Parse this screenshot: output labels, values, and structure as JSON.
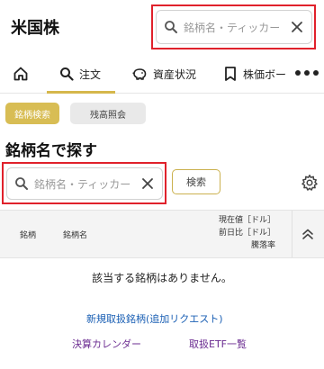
{
  "header": {
    "title": "米国株",
    "search_placeholder": "銘柄名・ティッカー"
  },
  "tabs": [
    {
      "label": "",
      "icon": "home-icon"
    },
    {
      "label": "注文",
      "icon": "search-icon",
      "active": true
    },
    {
      "label": "資産状況",
      "icon": "piggy-bank-icon"
    },
    {
      "label": "株価ボー",
      "icon": "bookmark-icon"
    }
  ],
  "segments": {
    "active_label": "銘柄検索",
    "inactive_label": "残高照会"
  },
  "search_section": {
    "title": "銘柄名で探す",
    "placeholder": "銘柄名・ティッカー",
    "button_label": "検索"
  },
  "table": {
    "columns": {
      "col1": "銘柄",
      "col2": "銘柄名",
      "col3_line1": "現在値［ドル］",
      "col3_line2": "前日比［ドル］",
      "col3_line3": "騰落率"
    },
    "empty_message": "該当する銘柄はありません。"
  },
  "links": {
    "new_request": "新規取扱銘柄(追加リクエスト)",
    "earnings_calendar": "決算カレンダー",
    "etf_list": "取扱ETF一覧"
  },
  "colors": {
    "accent_gold": "#d8bd54",
    "highlight_red": "#e0212b",
    "link_blue": "#1a5fb4",
    "link_purple": "#6b2c91"
  }
}
